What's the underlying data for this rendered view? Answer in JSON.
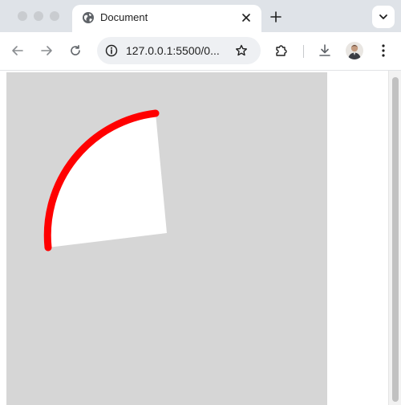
{
  "tab": {
    "title": "Document",
    "favicon": "globe-icon"
  },
  "address_bar": {
    "url": "127.0.0.1:5500/0..."
  },
  "icons": {
    "back": "arrow-left-icon",
    "forward": "arrow-right-icon",
    "reload": "reload-icon",
    "site_info": "info-icon",
    "bookmark": "star-icon",
    "extensions": "puzzle-icon",
    "download": "download-icon",
    "menu": "kebab-menu-icon",
    "new_tab": "plus-icon",
    "close_tab": "close-icon",
    "tab_search": "chevron-down-icon"
  },
  "canvas": {
    "background_color": "#d6d6d6",
    "sector_fill": "#ffffff",
    "arc_stroke": "#ff0000"
  }
}
